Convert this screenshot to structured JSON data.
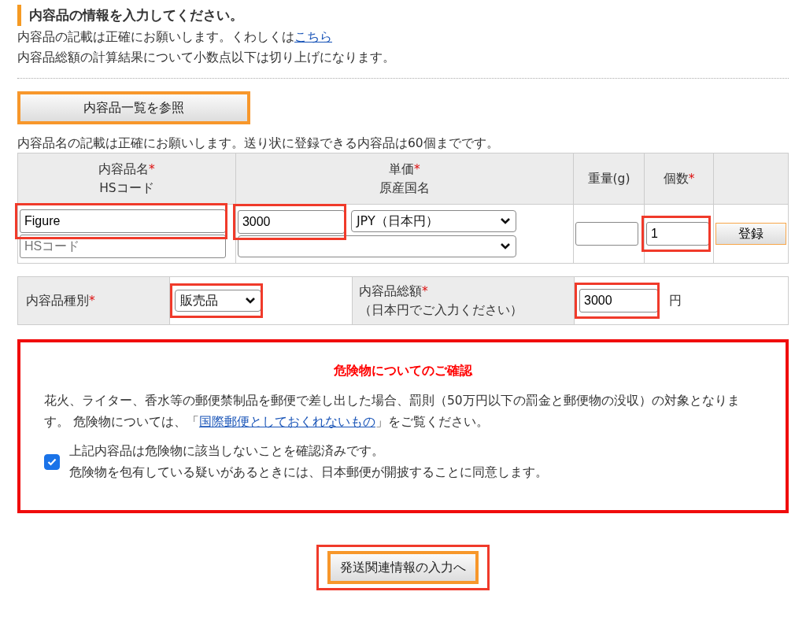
{
  "heading": "内容品の情報を入力してください。",
  "intro": {
    "text": "内容品の記載は正確にお願いします。くわしくは",
    "link": "こちら",
    "line2": "内容品総額の計算結果について小数点以下は切り上げになります。"
  },
  "browse_button": "内容品一覧を参照",
  "note": "内容品名の記載は正確にお願いします。送り状に登録できる内容品は60個までです。",
  "items_table": {
    "columns": [
      {
        "lines": [
          "内容品名",
          "HSコード"
        ],
        "mark": "*"
      },
      {
        "lines": [
          "単価",
          "原産国名"
        ],
        "mark": "*"
      },
      {
        "lines": [
          "重量(g)"
        ]
      },
      {
        "lines": [
          "個数"
        ],
        "mark": "*"
      },
      {}
    ],
    "name": {
      "value": "Figure",
      "highlighted": true
    },
    "hs_code": {
      "placeholder": "HSコード"
    },
    "price": {
      "value": "3000",
      "highlighted": true
    },
    "currency": {
      "value": "JPY（日本円）"
    },
    "quantity": {
      "value": "1",
      "highlighted": true
    },
    "register_button": "登録"
  },
  "summary": {
    "type_label": "内容品種別",
    "type_mark": "*",
    "type_value": "販売品",
    "type_highlighted": true,
    "total_label": "内容品総額",
    "total_mark": "*",
    "total_hint": "（日本円でご入力ください）",
    "total_value": "3000",
    "total_highlighted": true,
    "unit": "円"
  },
  "warning": {
    "title": "危険物についてのご確認",
    "text_before": "花火、ライター、香水等の郵便禁制品を郵便で差し出した場合、罰則（50万円以下の罰金と郵便物の没収）の対象となります。 危険物については、「",
    "link": "国際郵便としておくれないもの",
    "text_after": "」をご覧ください。",
    "confirm": {
      "checked": true,
      "lines": [
        "上記内容品は危険物に該当しないことを確認済みです。",
        "危険物を包有している疑いがあるときには、日本郵便が開披することに同意します。"
      ]
    }
  },
  "next_button": {
    "label": "発送関連情報の入力へ",
    "highlighted": true
  }
}
